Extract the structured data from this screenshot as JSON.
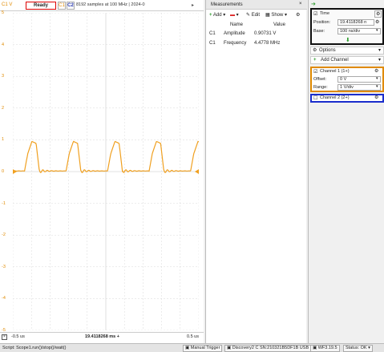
{
  "scope": {
    "channel_tag": "C1 V",
    "status": "Ready",
    "ch1_btn": "C1",
    "ch2_btn": "C2",
    "acq_info": "8192 samples at 100 MHz | 2024-0",
    "y_ticks": [
      "5",
      "4",
      "3",
      "2",
      "1",
      "0",
      "-1",
      "-2",
      "-3",
      "-4",
      "-5"
    ],
    "x_left": "-0.5 us",
    "x_center": "19.4118268 ms +",
    "x_right": "0.5 us",
    "trace_color": "#f0a020",
    "grid_color": "#d8d8d8"
  },
  "measurements": {
    "title": "Measurements",
    "toolbar": {
      "add": "Add",
      "remove": "",
      "edit": "Edit",
      "show": "Show"
    },
    "columns": [
      "Name",
      "Value"
    ],
    "rows": [
      {
        "ch": "C1",
        "name": "Amplitude",
        "value": "0.90731 V"
      },
      {
        "ch": "C1",
        "name": "Frequency",
        "value": "4.4778 MHz"
      }
    ]
  },
  "time": {
    "label": "Time",
    "position_label": "Position:",
    "position_value": "19.4118268 n",
    "base_label": "Base:",
    "base_value": "100 ns/div"
  },
  "options_label": "Options",
  "add_channel_label": "Add Channel",
  "channel1": {
    "label": "Channel 1 (1+)",
    "offset_label": "Offset:",
    "offset_value": "0 V",
    "range_label": "Range:",
    "range_value": "1 V/div"
  },
  "channel2": {
    "label": "Channel 2 (2+)"
  },
  "statusbar": {
    "script": "Script: Scope1.run()/stop()/wait()",
    "manual_trigger": "Manual Trigger",
    "device": "Discovery2 C SN:210321B5DF1B USB",
    "version": "WF3.19.5",
    "status": "Status: OK"
  }
}
